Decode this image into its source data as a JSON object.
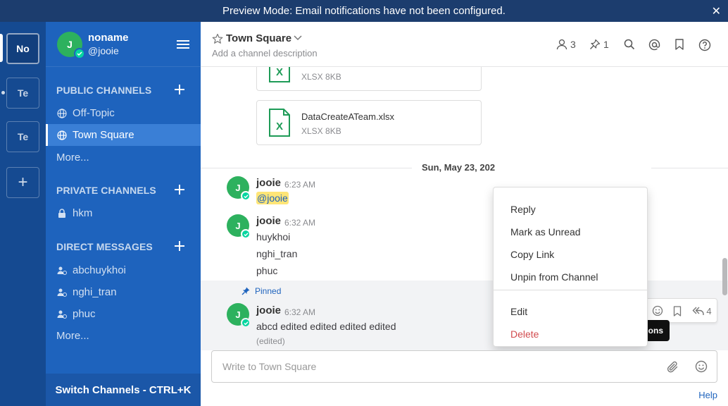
{
  "banner": {
    "text": "Preview Mode: Email notifications have not been configured.",
    "close": "✕"
  },
  "teams": [
    {
      "label": "No",
      "active": true
    },
    {
      "label": "Te"
    },
    {
      "label": "Te"
    },
    {
      "label": "+"
    }
  ],
  "user": {
    "avatar": "J",
    "name": "noname",
    "handle": "@jooie"
  },
  "sidebar": {
    "public_title": "PUBLIC CHANNELS",
    "public": [
      {
        "label": "Off-Topic"
      },
      {
        "label": "Town Square",
        "active": true
      }
    ],
    "public_more": "More...",
    "private_title": "PRIVATE CHANNELS",
    "private": [
      {
        "label": "hkm"
      }
    ],
    "dm_title": "DIRECT MESSAGES",
    "dms": [
      {
        "label": "abchuykhoi"
      },
      {
        "label": "nghi_tran"
      },
      {
        "label": "phuc"
      }
    ],
    "dm_more": "More...",
    "switch": "Switch Channels - CTRL+K"
  },
  "channel": {
    "name": "Town Square",
    "description": "Add a channel description",
    "members": "3",
    "pinned": "1"
  },
  "files": [
    {
      "name": "",
      "meta": "XLSX 8KB"
    },
    {
      "name": "DataCreateATeam.xlsx",
      "meta": "XLSX 8KB"
    }
  ],
  "date_sep": "Sun, May 23, 202",
  "posts": [
    {
      "author": "jooie",
      "time": "6:23 AM",
      "lines": [
        "@jooie"
      ]
    },
    {
      "author": "jooie",
      "time": "6:32 AM",
      "lines": [
        "huykhoi",
        "nghi_tran",
        "phuc"
      ]
    },
    {
      "author": "jooie",
      "time": "6:32 AM",
      "pinned": "Pinned",
      "lines": [
        "abcd edited edited edited edited"
      ],
      "edited": "(edited)",
      "reply_count": "4"
    }
  ],
  "dropdown": {
    "items": [
      "Reply",
      "Mark as Unread",
      "Copy Link",
      "Unpin from Channel"
    ],
    "edit": "Edit",
    "delete": "Delete"
  },
  "tooltip": "More actions",
  "composer": {
    "placeholder": "Write to Town Square"
  },
  "help": "Help",
  "colors": {
    "sidebar": "#1e63bd",
    "team_bar": "#154a91",
    "banner": "#1c3d6e",
    "online": "#06d6a0",
    "avatar": "#2db15e",
    "danger": "#d24b4e",
    "mention": "#ffe577"
  }
}
